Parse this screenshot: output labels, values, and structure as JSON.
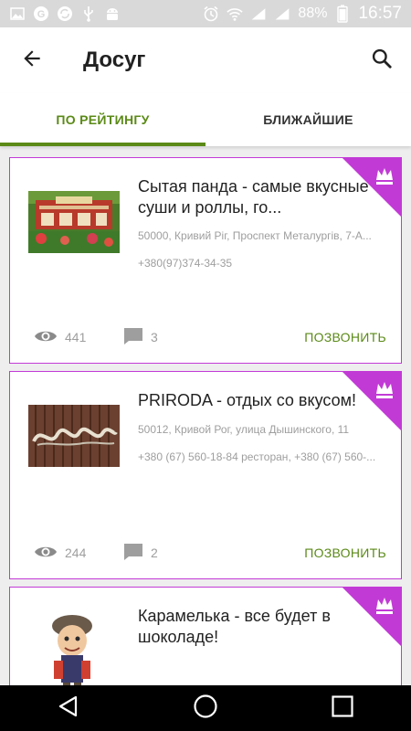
{
  "status_bar": {
    "battery_text": "88%",
    "time": "16:57",
    "left_icons": [
      "gallery-icon",
      "mail-icon",
      "sync-icon",
      "usb-icon",
      "android-icon"
    ],
    "right_icons": [
      "alarm-icon",
      "wifi-icon",
      "signal-icon",
      "signal-icon",
      "battery-icon"
    ]
  },
  "app_bar": {
    "title": "Досуг",
    "back_icon": "arrow-left-icon",
    "search_icon": "search-icon"
  },
  "tabs": [
    {
      "label": "ПО РЕЙТИНГУ",
      "active": true
    },
    {
      "label": "БЛИЖАЙШИЕ",
      "active": false
    }
  ],
  "colors": {
    "accent_green": "#5b8a17",
    "premium_purple": "#c23ad6",
    "status_bar_bg": "#d9d9d9"
  },
  "cards": [
    {
      "title": "Сытая панда - самые вкусные суши и роллы,  го...",
      "address": "50000, Кривий Ріг, Проспект Металургів, 7-А...",
      "phone": "+380(97)374-34-35",
      "views": "441",
      "comments": "3",
      "action": "ПОЗВОНИТЬ",
      "premium": true
    },
    {
      "title": "PRIRODA - отдых со вкусом!",
      "address": "50012, Кривой Рог, улица Дышинского, 11",
      "phone": "+380 (67) 560-18-84 ресторан, +380 (67) 560-...",
      "views": "244",
      "comments": "2",
      "action": "ПОЗВОНИТЬ",
      "premium": true
    },
    {
      "title": "Карамелька - все будет в шоколаде!",
      "premium": true
    }
  ],
  "nav_bar": {
    "icons": [
      "back-triangle-icon",
      "home-circle-icon",
      "recents-square-icon"
    ]
  }
}
